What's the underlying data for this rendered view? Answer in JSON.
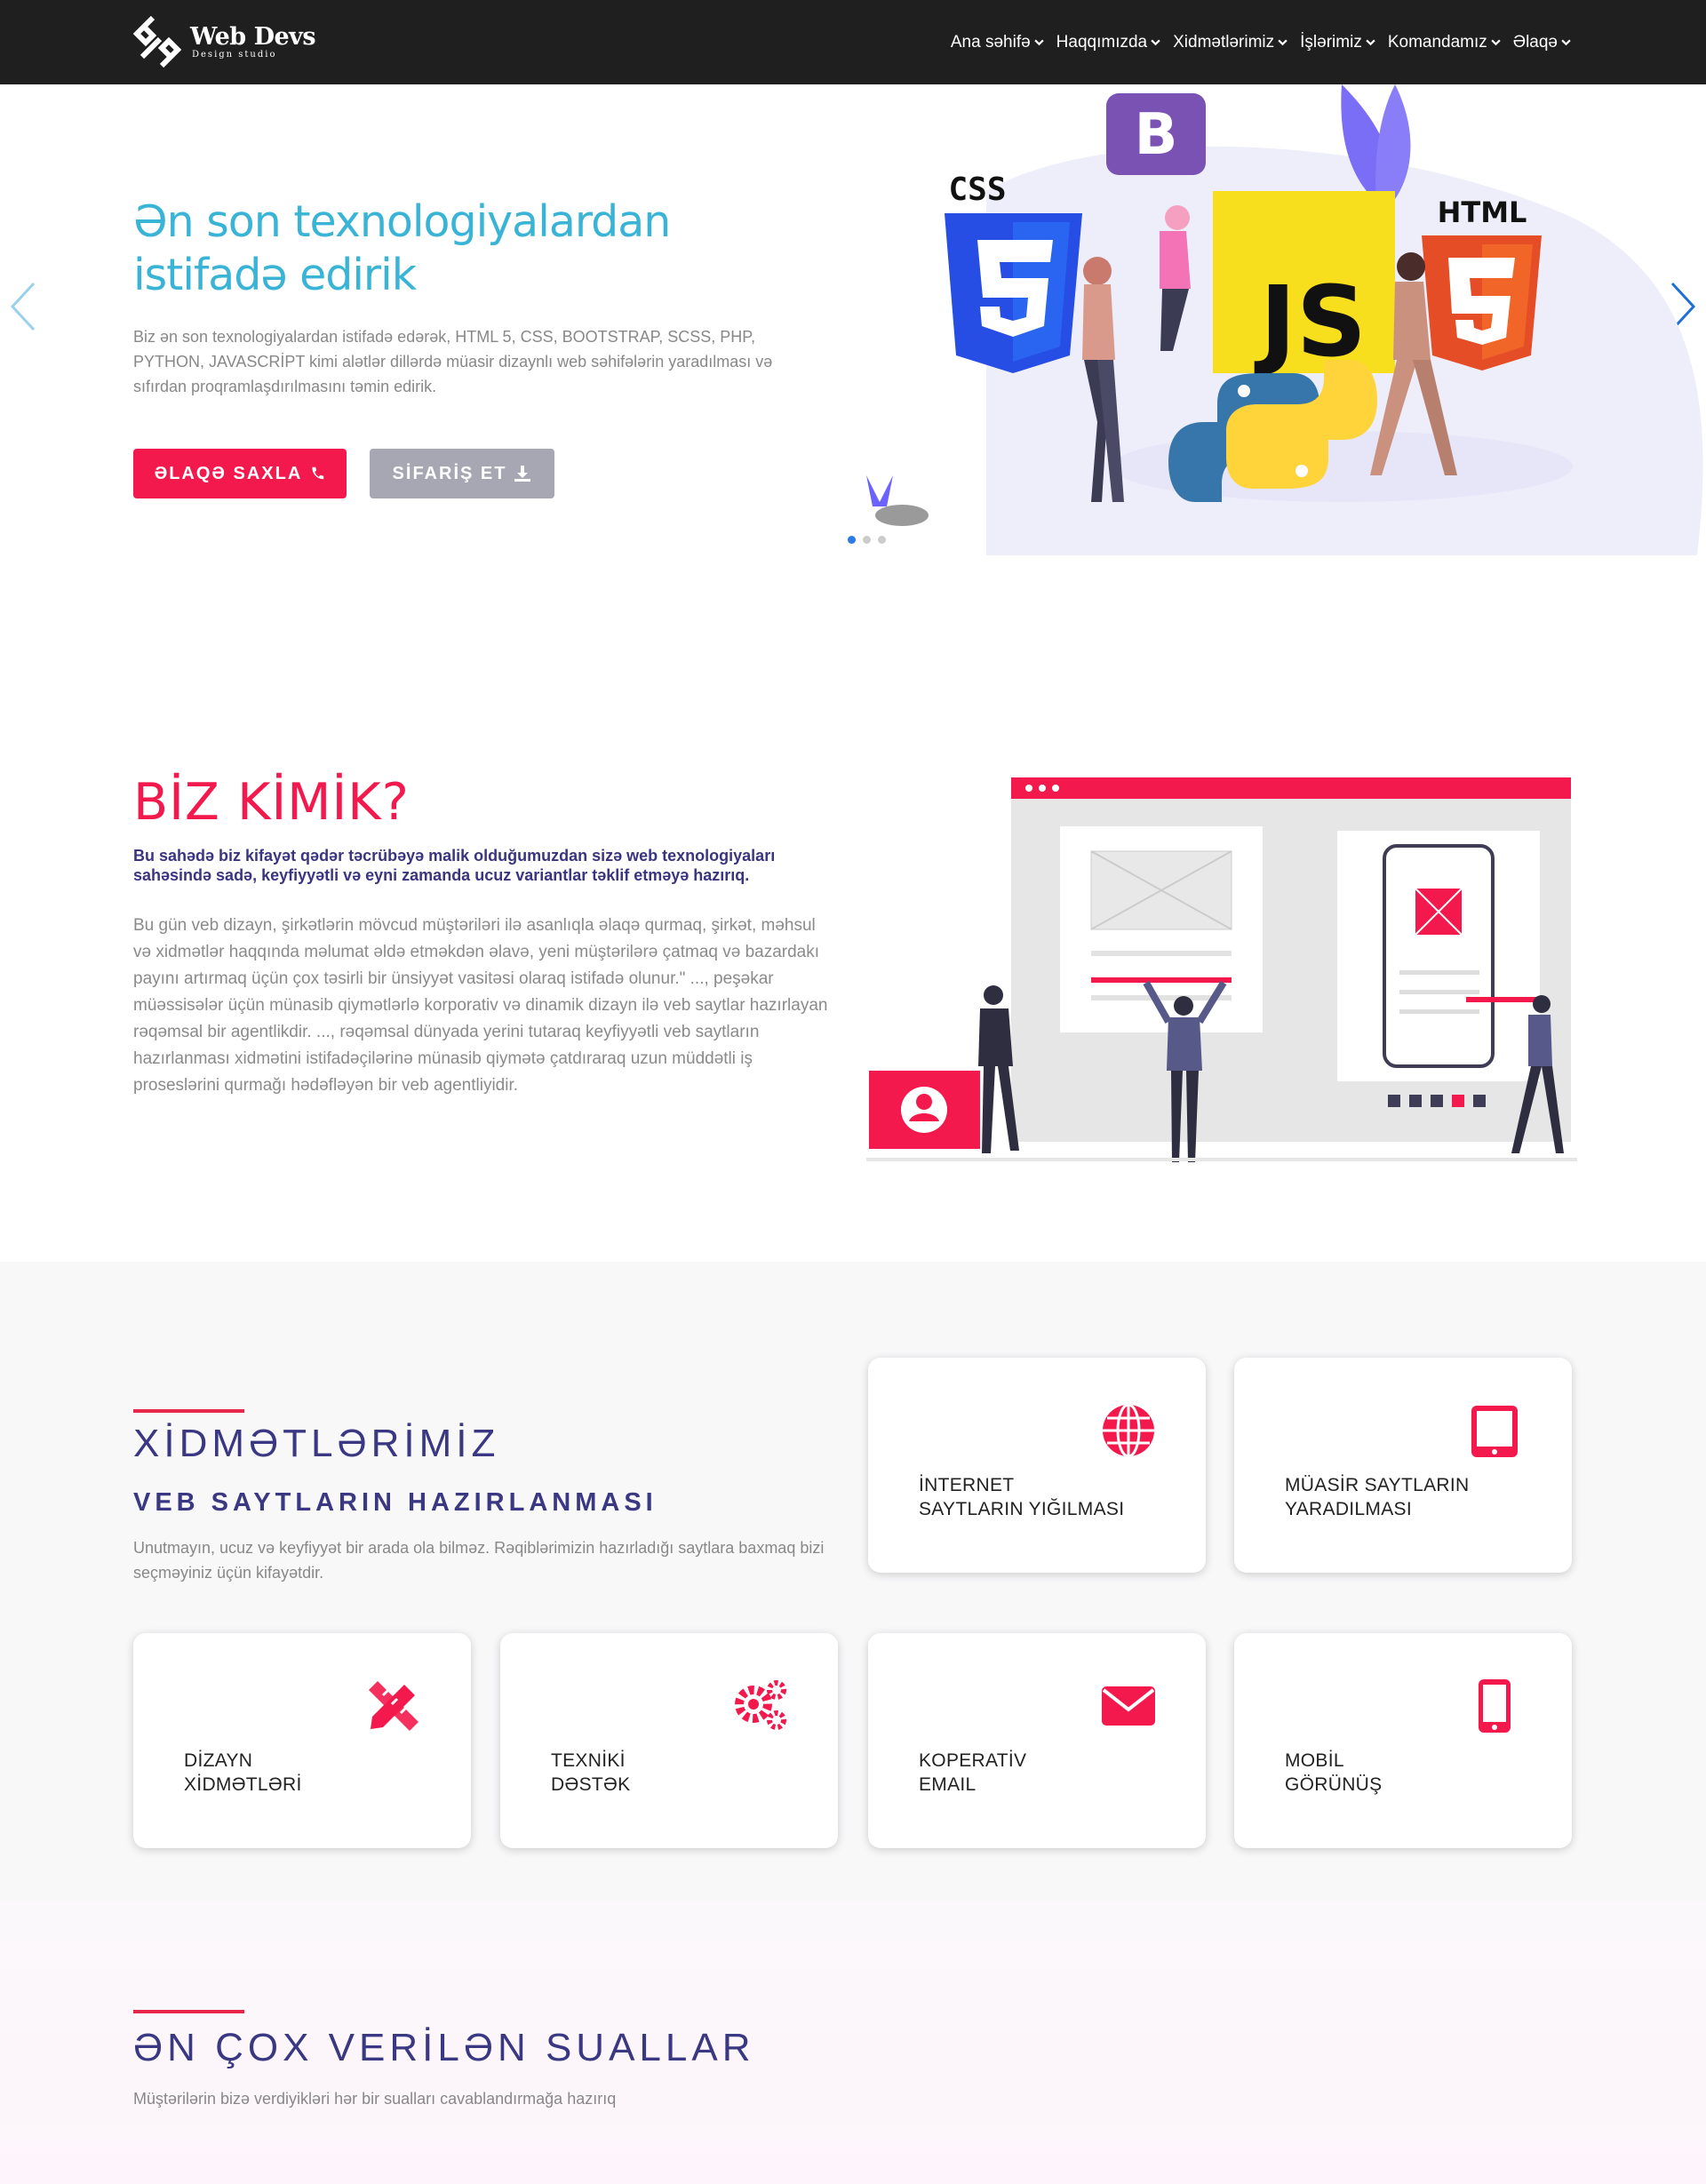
{
  "brand": {
    "name": "Web Devs",
    "tagline": "Design studio"
  },
  "nav": {
    "items": [
      {
        "label": "Ana səhifə"
      },
      {
        "label": "Haqqımızda"
      },
      {
        "label": "Xidmətlərimiz"
      },
      {
        "label": "İşlərimiz"
      },
      {
        "label": "Komandamız"
      },
      {
        "label": "Əlaqə"
      }
    ]
  },
  "hero": {
    "title": "Ən son texnologiyalardan istifadə edirik",
    "text": "Biz ən son texnologiyalardan istifadə edərək, HTML 5, CSS, BOOTSTRAP, SCSS, PHP, PYTHON, JAVASCRİPT kimi alətlər dillərdə müasir dizaynlı web səhifələrin yaradılması və sıfırdan proqramlaşdırılmasını təmin edirik.",
    "contact_button": "ƏLAQƏ SAXLA",
    "order_button": "SİFARİŞ ET",
    "slides": 3,
    "active_slide": 1,
    "art_labels": {
      "css": "CSS",
      "html": "HTML",
      "bootstrap": "B",
      "js": "JS"
    }
  },
  "about": {
    "title": "BİZ KİMİK?",
    "lead": "Bu sahədə biz kifayət qədər təcrübəyə malik olduğumuzdan sizə web texnologiyaları sahəsində sadə, keyfiyyətli və eyni zamanda ucuz variantlar təklif etməyə hazırıq.",
    "text": "Bu gün veb dizayn, şirkətlərin mövcud müştəriləri ilə asanlıqla əlaqə qurmaq, şirkət, məhsul və xidmətlər haqqında məlumat əldə etməkdən əlavə, yeni müştərilərə çatmaq və bazardakı payını artırmaq üçün çox təsirli bir ünsiyyət vasitəsi olaraq istifadə olunur.\" ..., peşəkar müəssisələr üçün münasib qiymətlərlə korporativ və dinamik dizayn ilə veb saytlar hazırlayan rəqəmsal bir agentlikdir. ..., rəqəmsal dünyada yerini tutaraq keyfiyyətli veb saytların hazırlanması xidmətini istifadəçilərinə münasib qiymətə çatdıraraq uzun müddətli iş proseslərini qurmağı hədəfləyən bir veb agentliyidir."
  },
  "services": {
    "title": "XİDMƏTLƏRİMİZ",
    "subtitle": "VEB SAYTLARIN HAZIRLANMASI",
    "text": "Unutmayın, ucuz və keyfiyyət bir arada ola bilməz. Rəqiblərimizin hazırladığı saytlara baxmaq bizi seçməyiniz üçün kifayətdir.",
    "cards": [
      {
        "label": "İNTERNET\nSAYTLARIN YIĞILMASI",
        "icon": "globe-icon"
      },
      {
        "label": "MÜASİR SAYTLARIN\nYARADILMASI",
        "icon": "tablet-icon"
      },
      {
        "label": "DİZAYN\nXİDMƏTLƏRİ",
        "icon": "design-tools-icon"
      },
      {
        "label": "TEXNİKİ\nDƏSTƏK",
        "icon": "gears-icon"
      },
      {
        "label": "KOPERATİV\nEMAIL",
        "icon": "envelope-icon"
      },
      {
        "label": "MOBİL\nGÖRÜNÜŞ",
        "icon": "mobile-icon"
      }
    ],
    "accent": "#f4194d"
  },
  "faq": {
    "title": "ƏN ÇOX VERİLƏN SUALLAR",
    "text": "Müştərilərin bizə verdiyikləri hər bir sualları cavablandırmağa hazırıq"
  }
}
